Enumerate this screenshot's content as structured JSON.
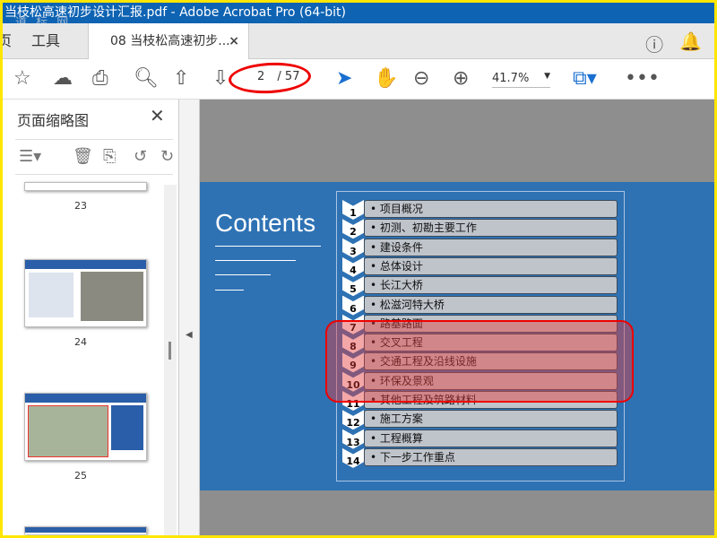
{
  "window": {
    "title": "当枝松高速初步设计汇报.pdf - Adobe Acrobat Pro (64-bit)",
    "watermark": "道 标 网"
  },
  "tabs": {
    "home_partial": "页",
    "tools": "工具",
    "document": "08 当枝松高速初步...",
    "close": "×"
  },
  "toolbar": {
    "page_current": "2",
    "page_total": "/ 57",
    "zoom": "41.7%"
  },
  "sidebar": {
    "title": "页面缩略图",
    "close": "✕",
    "thumbnails": [
      {
        "label": "23"
      },
      {
        "label": "24"
      },
      {
        "label": "25"
      }
    ]
  },
  "slide": {
    "title": "Contents",
    "items": [
      {
        "n": "1",
        "text": "项目概况"
      },
      {
        "n": "2",
        "text": "初测、初勘主要工作"
      },
      {
        "n": "3",
        "text": "建设条件"
      },
      {
        "n": "4",
        "text": "总体设计"
      },
      {
        "n": "5",
        "text": "长江大桥"
      },
      {
        "n": "6",
        "text": "松滋河特大桥"
      },
      {
        "n": "7",
        "text": "路基路面"
      },
      {
        "n": "8",
        "text": "交叉工程"
      },
      {
        "n": "9",
        "text": "交通工程及沿线设施"
      },
      {
        "n": "10",
        "text": "环保及景观"
      },
      {
        "n": "11",
        "text": "其他工程及筑路材料"
      },
      {
        "n": "12",
        "text": "施工方案"
      },
      {
        "n": "13",
        "text": "工程概算"
      },
      {
        "n": "14",
        "text": "下一步工作重点"
      }
    ]
  }
}
